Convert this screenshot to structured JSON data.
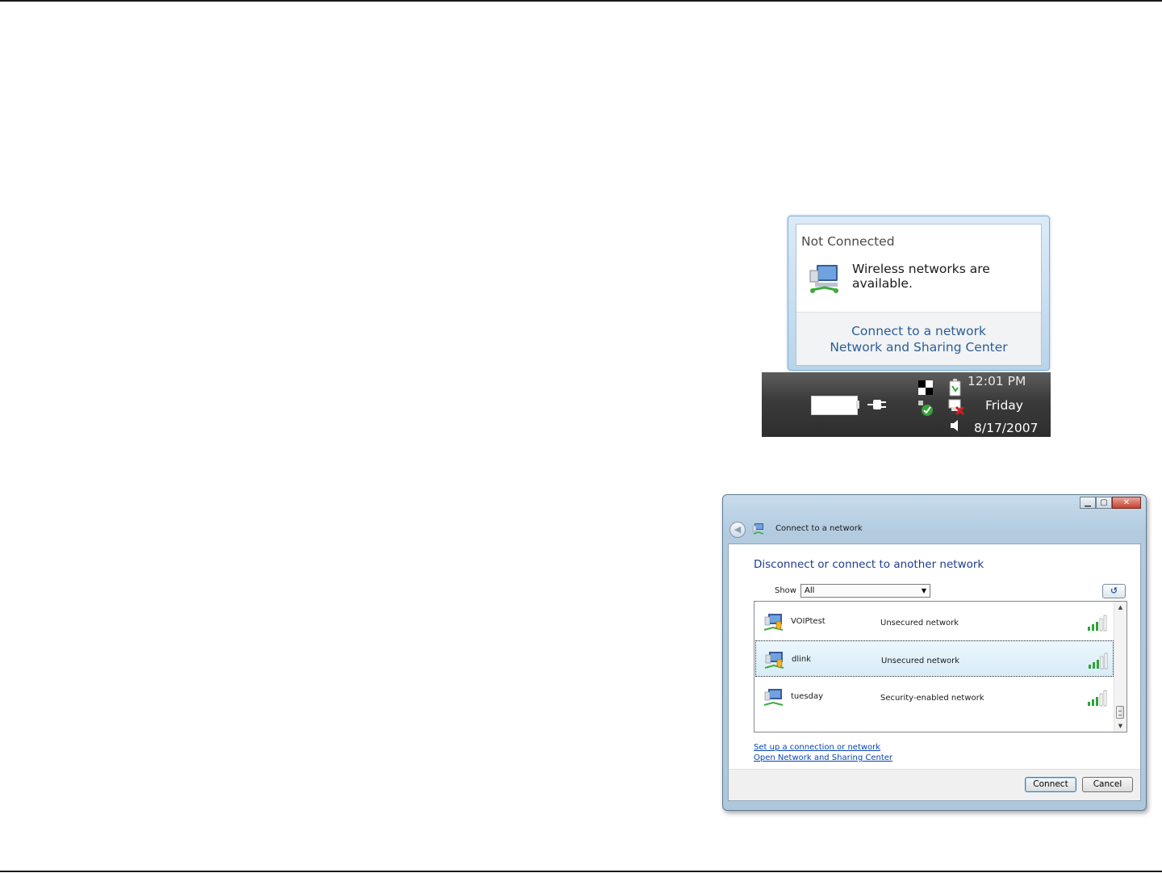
{
  "balloon": {
    "title": "Not Connected",
    "message": "Wireless networks are available.",
    "links": [
      "Connect to a network",
      "Network and Sharing Center"
    ]
  },
  "taskbar": {
    "time": "12:01 PM",
    "day": "Friday",
    "date": "8/17/2007"
  },
  "dialog": {
    "title": "Connect to a network",
    "heading": "Disconnect or connect to another network",
    "show_label": "Show",
    "show_value": "All",
    "networks": [
      {
        "name": "VOIPtest",
        "security": "Unsecured network",
        "selected": false
      },
      {
        "name": "dlink",
        "security": "Unsecured network",
        "selected": true
      },
      {
        "name": "tuesday",
        "security": "Security-enabled network",
        "selected": false
      }
    ],
    "links": [
      "Set up a connection or network",
      "Open Network and Sharing Center"
    ],
    "connect_label": "Connect",
    "cancel_label": "Cancel"
  },
  "colors": {
    "link": "#2c5d96",
    "heading": "#1e3c8c",
    "selection": "#d7ecf8",
    "signal_bar": "#2fa33a"
  }
}
